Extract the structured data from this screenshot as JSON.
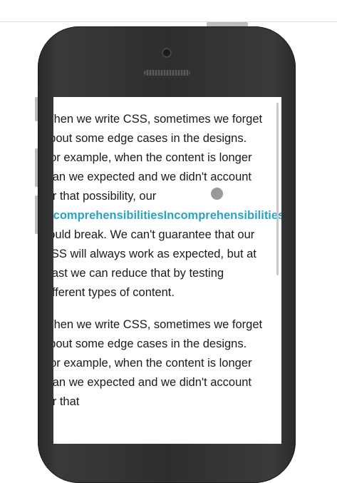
{
  "paragraphs": [
    {
      "before": "When we write CSS, sometimes we forget about some edge cases in the designs. For example, when the content is longer than we expected and we didn't account for that possibility, our ",
      "long_word": "IncomprehensibilitiesIncomprehensibilities",
      "after": " could break. We can't guarantee that our CSS will always work as expected, but at least we can reduce that by testing different types of content."
    },
    {
      "before": "When we write CSS, sometimes we forget about some edge cases in the designs. For example, when the content is longer than we expected and we didn't account for that"
    }
  ],
  "colors": {
    "accent": "#2ba3c4",
    "phone_body": "#2e2e2e"
  }
}
